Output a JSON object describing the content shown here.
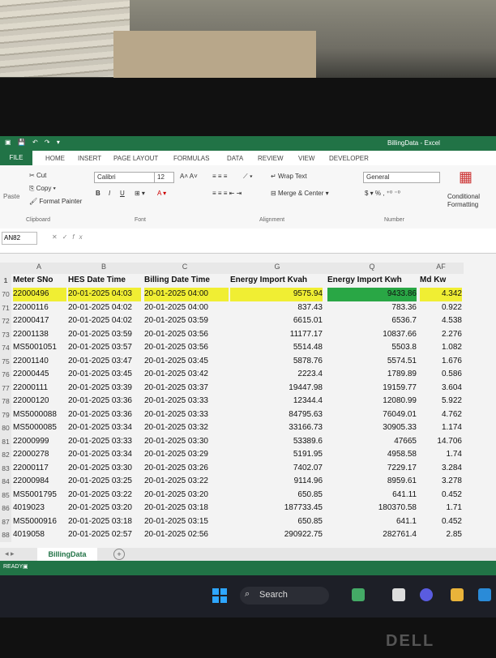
{
  "window": {
    "file_name": "BillingData",
    "app_name": "Excel"
  },
  "ribbon_tabs": [
    "FILE",
    "HOME",
    "INSERT",
    "PAGE LAYOUT",
    "FORMULAS",
    "DATA",
    "REVIEW",
    "VIEW",
    "DEVELOPER"
  ],
  "ribbon": {
    "cut": "Cut",
    "copy": "Copy",
    "paste": "Paste",
    "format_painter": "Format Painter",
    "font_name": "Calibri",
    "font_size": "12",
    "bold": "B",
    "italic": "I",
    "underline": "U",
    "wrap_text": "Wrap Text",
    "merge_center": "Merge & Center",
    "number_format": "General",
    "conditional_formatting": "Conditional Formatting",
    "groups": {
      "clipboard": "Clipboard",
      "font": "Font",
      "alignment": "Alignment",
      "number": "Number"
    }
  },
  "formula_bar": {
    "name_box": "AN82",
    "fx": "fx",
    "value": ""
  },
  "column_letters": [
    "A",
    "B",
    "C",
    "G",
    "Q",
    "AF"
  ],
  "headers": [
    "Meter SNo",
    "HES Date Time",
    "Billing Date Time",
    "Energy Import Kvah",
    "Energy Import Kwh",
    "Md Kw"
  ],
  "rows": [
    {
      "n": "70",
      "meter": "22000496",
      "hes": "20-01-2025 04:03",
      "billing": "20-01-2025 04:00",
      "kvah": "9575.94",
      "kwh": "9433.86",
      "md": "4.342"
    },
    {
      "n": "71",
      "meter": "22000116",
      "hes": "20-01-2025 04:02",
      "billing": "20-01-2025 04:00",
      "kvah": "837.43",
      "kwh": "783.36",
      "md": "0.922"
    },
    {
      "n": "72",
      "meter": "22000417",
      "hes": "20-01-2025 04:02",
      "billing": "20-01-2025 03:59",
      "kvah": "6615.01",
      "kwh": "6536.7",
      "md": "4.538"
    },
    {
      "n": "73",
      "meter": "22001138",
      "hes": "20-01-2025 03:59",
      "billing": "20-01-2025 03:56",
      "kvah": "11177.17",
      "kwh": "10837.66",
      "md": "2.276"
    },
    {
      "n": "74",
      "meter": "MS5001051",
      "hes": "20-01-2025 03:57",
      "billing": "20-01-2025 03:56",
      "kvah": "5514.48",
      "kwh": "5503.8",
      "md": "1.082"
    },
    {
      "n": "75",
      "meter": "22001140",
      "hes": "20-01-2025 03:47",
      "billing": "20-01-2025 03:45",
      "kvah": "5878.76",
      "kwh": "5574.51",
      "md": "1.676"
    },
    {
      "n": "76",
      "meter": "22000445",
      "hes": "20-01-2025 03:45",
      "billing": "20-01-2025 03:42",
      "kvah": "2223.4",
      "kwh": "1789.89",
      "md": "0.586"
    },
    {
      "n": "77",
      "meter": "22000111",
      "hes": "20-01-2025 03:39",
      "billing": "20-01-2025 03:37",
      "kvah": "19447.98",
      "kwh": "19159.77",
      "md": "3.604"
    },
    {
      "n": "78",
      "meter": "22000120",
      "hes": "20-01-2025 03:36",
      "billing": "20-01-2025 03:33",
      "kvah": "12344.4",
      "kwh": "12080.99",
      "md": "5.922"
    },
    {
      "n": "79",
      "meter": "MS5000088",
      "hes": "20-01-2025 03:36",
      "billing": "20-01-2025 03:33",
      "kvah": "84795.63",
      "kwh": "76049.01",
      "md": "4.762"
    },
    {
      "n": "80",
      "meter": "MS5000085",
      "hes": "20-01-2025 03:34",
      "billing": "20-01-2025 03:32",
      "kvah": "33166.73",
      "kwh": "30905.33",
      "md": "1.174"
    },
    {
      "n": "81",
      "meter": "22000999",
      "hes": "20-01-2025 03:33",
      "billing": "20-01-2025 03:30",
      "kvah": "53389.6",
      "kwh": "47665",
      "md": "14.706"
    },
    {
      "n": "82",
      "meter": "22000278",
      "hes": "20-01-2025 03:34",
      "billing": "20-01-2025 03:29",
      "kvah": "5191.95",
      "kwh": "4958.58",
      "md": "1.74"
    },
    {
      "n": "83",
      "meter": "22000117",
      "hes": "20-01-2025 03:30",
      "billing": "20-01-2025 03:26",
      "kvah": "7402.07",
      "kwh": "7229.17",
      "md": "3.284"
    },
    {
      "n": "84",
      "meter": "22000984",
      "hes": "20-01-2025 03:25",
      "billing": "20-01-2025 03:22",
      "kvah": "9114.96",
      "kwh": "8959.61",
      "md": "3.278"
    },
    {
      "n": "85",
      "meter": "MS5001795",
      "hes": "20-01-2025 03:22",
      "billing": "20-01-2025 03:20",
      "kvah": "650.85",
      "kwh": "641.11",
      "md": "0.452"
    },
    {
      "n": "86",
      "meter": "4019023",
      "hes": "20-01-2025 03:20",
      "billing": "20-01-2025 03:18",
      "kvah": "187733.45",
      "kwh": "180370.58",
      "md": "1.71"
    },
    {
      "n": "87",
      "meter": "MS5000916",
      "hes": "20-01-2025 03:18",
      "billing": "20-01-2025 03:15",
      "kvah": "650.85",
      "kwh": "641.1",
      "md": "0.452"
    },
    {
      "n": "88",
      "meter": "4019058",
      "hes": "20-01-2025 02:57",
      "billing": "20-01-2025 02:56",
      "kvah": "290922.75",
      "kwh": "282761.4",
      "md": "2.85"
    }
  ],
  "sheet_tab": "BillingData",
  "add_sheet": "+",
  "status": "READY",
  "taskbar": {
    "search_label": "Search"
  },
  "brand": "DELL",
  "colors": {
    "excel_green": "#217346",
    "highlight_yellow": "#f0ee33",
    "highlight_green": "#29a745"
  }
}
